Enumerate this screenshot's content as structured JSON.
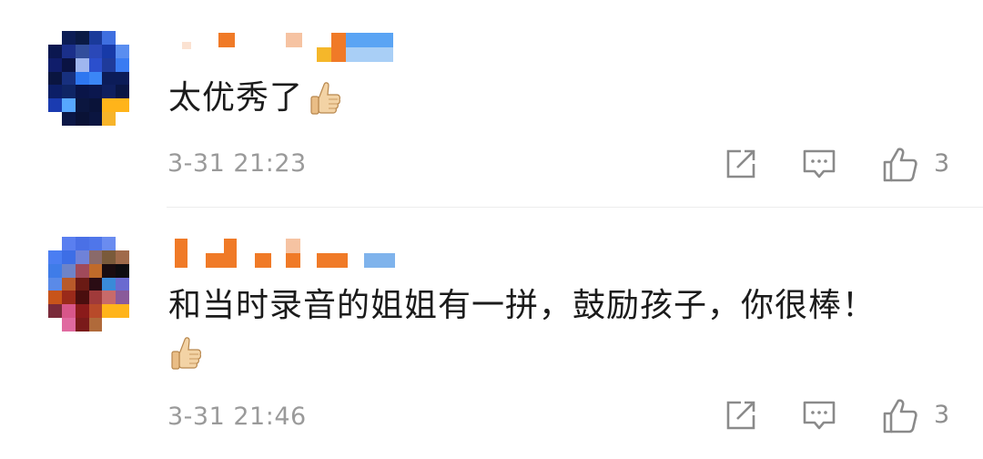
{
  "comments": [
    {
      "text": "太优秀了",
      "emoji": "thumbs-up",
      "time": "3-31 21:23",
      "like_count": "3"
    },
    {
      "text": "和当时录音的姐姐有一拼，鼓励孩子，你很棒！",
      "emoji": "thumbs-up",
      "time": "3-31 21:46",
      "like_count": "3"
    }
  ],
  "colors": {
    "text": "#1b1b1b",
    "meta": "#9a9a9a",
    "icon": "#8a8a8a",
    "divider": "#ececec",
    "username_orange": "#f07a27",
    "username_blue": "#6aaaf0"
  },
  "icons": [
    "share-icon",
    "reply-icon",
    "like-icon",
    "thumbs-up-emoji"
  ]
}
